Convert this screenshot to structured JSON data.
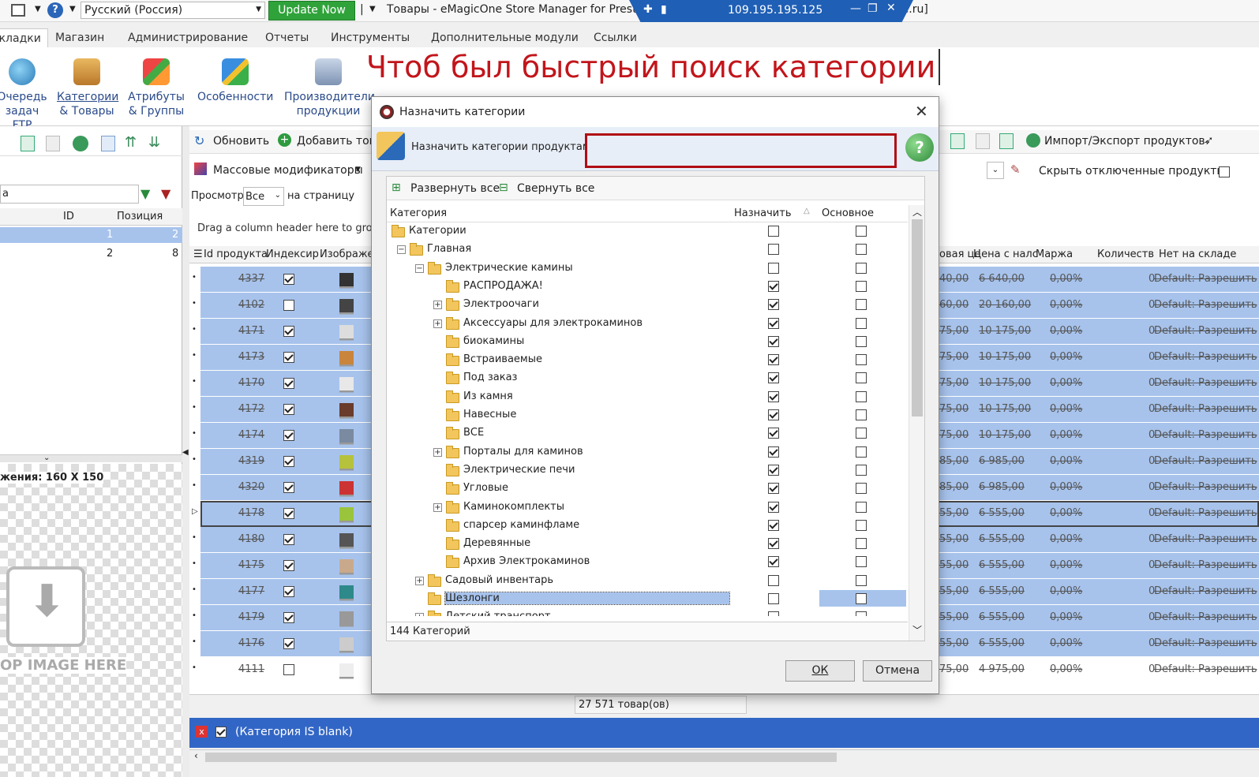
{
  "topbar": {
    "language": "Русский (Россия)",
    "update_button": "Update Now",
    "window_title": "Товары - eMagicOne Store Manager for PrestaShop Professional Edition (build 2379) [ВВ-store.ru]",
    "remote_ip": "109.195.195.125"
  },
  "menu": {
    "items": [
      "Вкладки",
      "Магазин",
      "Администрирование",
      "Отчеты",
      "Инструменты",
      "Дополнительные модули",
      "Ссылки"
    ]
  },
  "ribbon": {
    "buttons": [
      {
        "line1": "Очередь",
        "line2": "задач FTP"
      },
      {
        "line1": "Категории",
        "line2": "& Товары"
      },
      {
        "line1": "Атрибуты",
        "line2": "& Группы"
      },
      {
        "line1": "Особенности",
        "line2": ""
      },
      {
        "line1": "Производители",
        "line2": "продукции"
      }
    ]
  },
  "annotation": "Чтоб был быстрый поиск категории",
  "left_panel": {
    "col_id": "ID",
    "col_position": "Позиция",
    "rows": [
      {
        "id": "1",
        "pos": "2"
      },
      {
        "id": "2",
        "pos": "8"
      }
    ],
    "image_size_label": "жения: 160 X 150",
    "drop_text": "OP IMAGE HERE"
  },
  "grid": {
    "refresh": "Обновить",
    "add": "Добавить това",
    "mass_modifiers": "Массовые модификаторы",
    "view_label": "Просмотр",
    "view_value": "Все",
    "per_page": "на страницу",
    "group_hint": "Drag a column header here to group b",
    "import_export": "Импорт/Экспорт продуктов",
    "hide_disabled": "Скрыть отключенные продукты",
    "headers": [
      "Id продукта",
      "Индексир",
      "Изображен",
      "овая це",
      "Цена с налс",
      "Маржа",
      "Количеств",
      "Нет на складе"
    ],
    "rows": [
      {
        "id": "4337",
        "idx": true,
        "base": "40,00",
        "tax": "6 640,00",
        "margin": "0,00%",
        "qty": "0",
        "oos": "Default: Разрешить"
      },
      {
        "id": "4102",
        "idx": false,
        "base": "60,00",
        "tax": "20 160,00",
        "margin": "0,00%",
        "qty": "0",
        "oos": "Default: Разрешить"
      },
      {
        "id": "4171",
        "idx": true,
        "base": "75,00",
        "tax": "10 175,00",
        "margin": "0,00%",
        "qty": "0",
        "oos": "Default: Разрешить"
      },
      {
        "id": "4173",
        "idx": true,
        "base": "75,00",
        "tax": "10 175,00",
        "margin": "0,00%",
        "qty": "0",
        "oos": "Default: Разрешить"
      },
      {
        "id": "4170",
        "idx": true,
        "base": "75,00",
        "tax": "10 175,00",
        "margin": "0,00%",
        "qty": "0",
        "oos": "Default: Разрешить"
      },
      {
        "id": "4172",
        "idx": true,
        "base": "75,00",
        "tax": "10 175,00",
        "margin": "0,00%",
        "qty": "0",
        "oos": "Default: Разрешить"
      },
      {
        "id": "4174",
        "idx": true,
        "base": "75,00",
        "tax": "10 175,00",
        "margin": "0,00%",
        "qty": "0",
        "oos": "Default: Разрешить"
      },
      {
        "id": "4319",
        "idx": true,
        "base": "85,00",
        "tax": "6 985,00",
        "margin": "0,00%",
        "qty": "0",
        "oos": "Default: Разрешить"
      },
      {
        "id": "4320",
        "idx": true,
        "base": "85,00",
        "tax": "6 985,00",
        "margin": "0,00%",
        "qty": "0",
        "oos": "Default: Разрешить"
      },
      {
        "id": "4178",
        "idx": true,
        "base": "55,00",
        "tax": "6 555,00",
        "margin": "0,00%",
        "qty": "0",
        "oos": "Default: Разрешить"
      },
      {
        "id": "4180",
        "idx": true,
        "base": "55,00",
        "tax": "6 555,00",
        "margin": "0,00%",
        "qty": "0",
        "oos": "Default: Разрешить"
      },
      {
        "id": "4175",
        "idx": true,
        "base": "55,00",
        "tax": "6 555,00",
        "margin": "0,00%",
        "qty": "0",
        "oos": "Default: Разрешить"
      },
      {
        "id": "4177",
        "idx": true,
        "base": "55,00",
        "tax": "6 555,00",
        "margin": "0,00%",
        "qty": "0",
        "oos": "Default: Разрешить"
      },
      {
        "id": "4179",
        "idx": true,
        "base": "55,00",
        "tax": "6 555,00",
        "margin": "0,00%",
        "qty": "0",
        "oos": "Default: Разрешить"
      },
      {
        "id": "4176",
        "idx": true,
        "base": "55,00",
        "tax": "6 555,00",
        "margin": "0,00%",
        "qty": "0",
        "oos": "Default: Разрешить"
      },
      {
        "id": "4111",
        "idx": false,
        "base": "75,00",
        "tax": "4 975,00",
        "margin": "0,00%",
        "qty": "0",
        "oos": "Default: Разрешить"
      }
    ],
    "count": "27 571 товар(ов)",
    "filter": "(Категория IS blank)"
  },
  "dialog": {
    "title": "Назначить категории",
    "header_label": "Назначить категории продуктам",
    "search_value": "",
    "expand_all": "Развернуть все",
    "collapse_all": "Свернуть все",
    "col_category": "Категория",
    "col_assign": "Назначить",
    "col_main": "Основное",
    "rows": [
      {
        "label": "Категории",
        "assign": false,
        "main": false
      },
      {
        "label": "Главная",
        "assign": false,
        "main": false
      },
      {
        "label": "Электрические камины",
        "assign": false,
        "main": false
      },
      {
        "label": "РАСПРОДАЖА!",
        "assign": true,
        "main": false
      },
      {
        "label": "Электроочаги",
        "assign": true,
        "main": false
      },
      {
        "label": "Аксессуары для электрокаминов",
        "assign": true,
        "main": false
      },
      {
        "label": "биокамины",
        "assign": true,
        "main": false
      },
      {
        "label": "Встраиваемые",
        "assign": true,
        "main": false
      },
      {
        "label": "Под заказ",
        "assign": true,
        "main": false
      },
      {
        "label": "Из камня",
        "assign": true,
        "main": false
      },
      {
        "label": "Навесные",
        "assign": true,
        "main": false
      },
      {
        "label": "ВСЕ",
        "assign": true,
        "main": false
      },
      {
        "label": "Порталы для каминов",
        "assign": true,
        "main": false
      },
      {
        "label": "Электрические печи",
        "assign": true,
        "main": false
      },
      {
        "label": "Угловые",
        "assign": true,
        "main": false
      },
      {
        "label": "Каминокомплекты",
        "assign": true,
        "main": false
      },
      {
        "label": "спарсер каминфламе",
        "assign": true,
        "main": false
      },
      {
        "label": "Деревянные",
        "assign": true,
        "main": false
      },
      {
        "label": "Архив Электрокаминов",
        "assign": true,
        "main": false
      },
      {
        "label": "Садовый инвентарь",
        "assign": false,
        "main": false
      },
      {
        "label": "Шезлонги",
        "assign": false,
        "main": false
      },
      {
        "label": "Детский транспорт",
        "assign": false,
        "main": false
      }
    ],
    "footer_count": "144 Категорий",
    "ok": "ОК",
    "cancel": "Отмена"
  }
}
